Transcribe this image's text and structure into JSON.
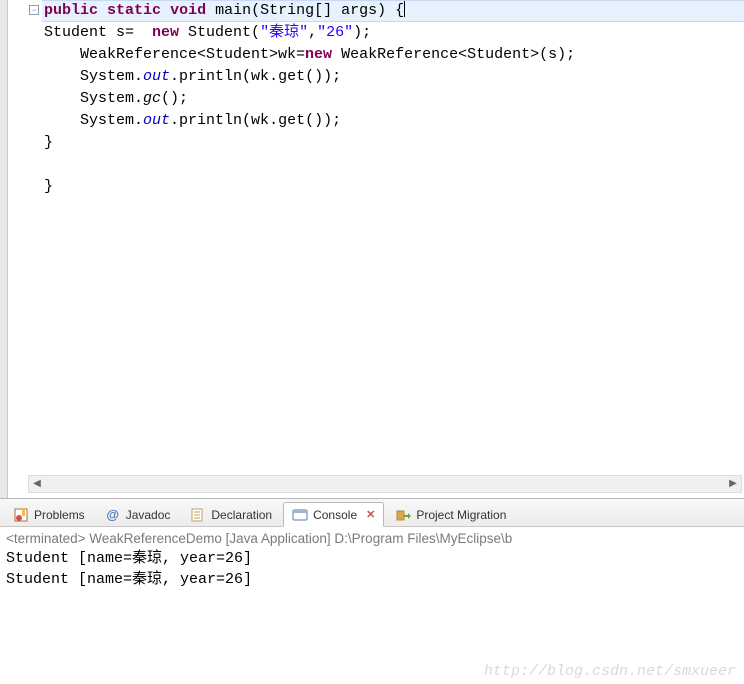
{
  "code": {
    "line1": {
      "kw_public": "public",
      "kw_static": "static",
      "kw_void": "void",
      "signature": " main(String[] args) {"
    },
    "line2": {
      "prefix": "Student s=  ",
      "kw_new": "new",
      "call": " Student(",
      "str1": "\"秦琼\"",
      "comma": ",",
      "str2": "\"26\"",
      "suffix": ");"
    },
    "line3": {
      "prefix": "    WeakReference<Student>wk=",
      "kw_new": "new",
      "suffix": " WeakReference<Student>(s);"
    },
    "line4": {
      "prefix": "    System.",
      "out": "out",
      "suffix": ".println(wk.get());"
    },
    "line5": {
      "prefix": "    System.",
      "gc": "gc",
      "suffix": "();"
    },
    "line6": {
      "prefix": "    System.",
      "out": "out",
      "suffix": ".println(wk.get());"
    },
    "line7": "}",
    "line8": " ",
    "line9": "}"
  },
  "tabs": {
    "problems": "Problems",
    "javadoc": "Javadoc",
    "declaration": "Declaration",
    "console": "Console",
    "migration": "Project Migration",
    "javadoc_at": "@"
  },
  "console": {
    "header": "<terminated> WeakReferenceDemo [Java Application] D:\\Program Files\\MyEclipse\\b",
    "out1": "Student [name=秦琼, year=26]",
    "out2": "Student [name=秦琼, year=26]"
  },
  "watermark": "http://blog.csdn.net/smxueer"
}
